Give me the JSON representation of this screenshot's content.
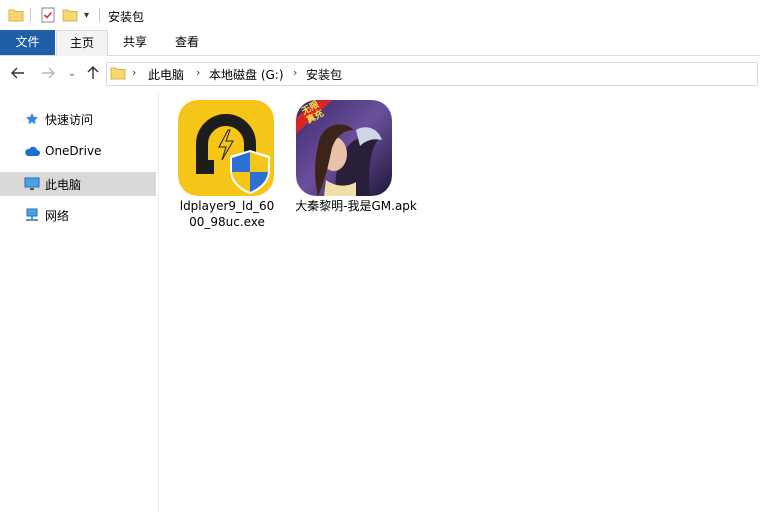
{
  "window": {
    "title": "安装包"
  },
  "ribbon": {
    "tabs": [
      "文件",
      "主页",
      "共享",
      "查看"
    ]
  },
  "address": {
    "crumbs": [
      "此电脑",
      "本地磁盘 (G:)",
      "安装包"
    ]
  },
  "sidebar": {
    "items": [
      {
        "label": "快速访问",
        "icon": "star-icon"
      },
      {
        "label": "OneDrive",
        "icon": "cloud-icon"
      },
      {
        "label": "此电脑",
        "icon": "computer-icon",
        "selected": true
      },
      {
        "label": "网络",
        "icon": "network-icon"
      }
    ]
  },
  "files": [
    {
      "name_line1": "ldplayer9_ld_60",
      "name_line2": "00_98uc.exe",
      "icon": "ldplayer-app-icon"
    },
    {
      "name_line1": "大秦黎明-我是GM.apk",
      "icon": "game-apk-icon",
      "badge": "无限 真充"
    }
  ],
  "colors": {
    "file_tab": "#1f5fa8",
    "folder": "#f7d774",
    "ld_yellow": "#f5c518",
    "selected": "#d9d9d9"
  }
}
